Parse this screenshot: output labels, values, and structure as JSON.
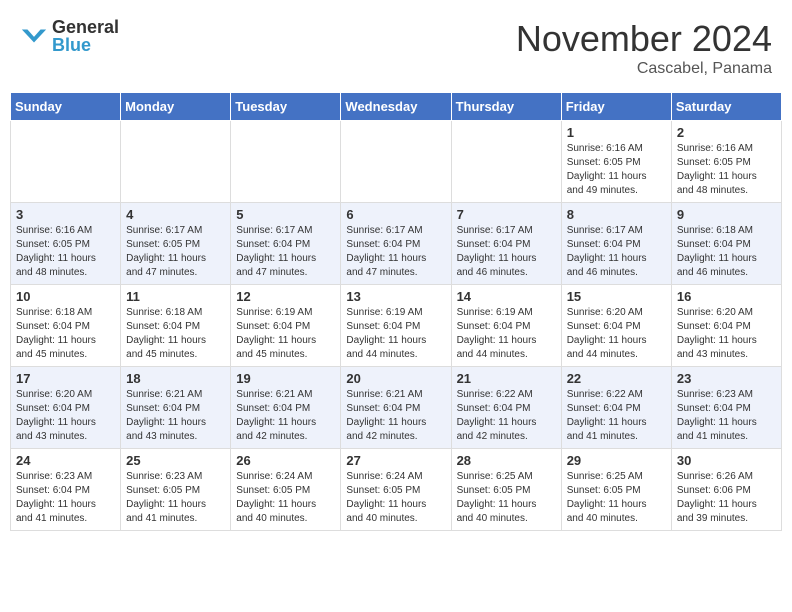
{
  "logo": {
    "general": "General",
    "blue": "Blue"
  },
  "title": "November 2024",
  "location": "Cascabel, Panama",
  "days_of_week": [
    "Sunday",
    "Monday",
    "Tuesday",
    "Wednesday",
    "Thursday",
    "Friday",
    "Saturday"
  ],
  "weeks": [
    [
      {
        "day": "",
        "info": ""
      },
      {
        "day": "",
        "info": ""
      },
      {
        "day": "",
        "info": ""
      },
      {
        "day": "",
        "info": ""
      },
      {
        "day": "",
        "info": ""
      },
      {
        "day": "1",
        "info": "Sunrise: 6:16 AM\nSunset: 6:05 PM\nDaylight: 11 hours and 49 minutes."
      },
      {
        "day": "2",
        "info": "Sunrise: 6:16 AM\nSunset: 6:05 PM\nDaylight: 11 hours and 48 minutes."
      }
    ],
    [
      {
        "day": "3",
        "info": "Sunrise: 6:16 AM\nSunset: 6:05 PM\nDaylight: 11 hours and 48 minutes."
      },
      {
        "day": "4",
        "info": "Sunrise: 6:17 AM\nSunset: 6:05 PM\nDaylight: 11 hours and 47 minutes."
      },
      {
        "day": "5",
        "info": "Sunrise: 6:17 AM\nSunset: 6:04 PM\nDaylight: 11 hours and 47 minutes."
      },
      {
        "day": "6",
        "info": "Sunrise: 6:17 AM\nSunset: 6:04 PM\nDaylight: 11 hours and 47 minutes."
      },
      {
        "day": "7",
        "info": "Sunrise: 6:17 AM\nSunset: 6:04 PM\nDaylight: 11 hours and 46 minutes."
      },
      {
        "day": "8",
        "info": "Sunrise: 6:17 AM\nSunset: 6:04 PM\nDaylight: 11 hours and 46 minutes."
      },
      {
        "day": "9",
        "info": "Sunrise: 6:18 AM\nSunset: 6:04 PM\nDaylight: 11 hours and 46 minutes."
      }
    ],
    [
      {
        "day": "10",
        "info": "Sunrise: 6:18 AM\nSunset: 6:04 PM\nDaylight: 11 hours and 45 minutes."
      },
      {
        "day": "11",
        "info": "Sunrise: 6:18 AM\nSunset: 6:04 PM\nDaylight: 11 hours and 45 minutes."
      },
      {
        "day": "12",
        "info": "Sunrise: 6:19 AM\nSunset: 6:04 PM\nDaylight: 11 hours and 45 minutes."
      },
      {
        "day": "13",
        "info": "Sunrise: 6:19 AM\nSunset: 6:04 PM\nDaylight: 11 hours and 44 minutes."
      },
      {
        "day": "14",
        "info": "Sunrise: 6:19 AM\nSunset: 6:04 PM\nDaylight: 11 hours and 44 minutes."
      },
      {
        "day": "15",
        "info": "Sunrise: 6:20 AM\nSunset: 6:04 PM\nDaylight: 11 hours and 44 minutes."
      },
      {
        "day": "16",
        "info": "Sunrise: 6:20 AM\nSunset: 6:04 PM\nDaylight: 11 hours and 43 minutes."
      }
    ],
    [
      {
        "day": "17",
        "info": "Sunrise: 6:20 AM\nSunset: 6:04 PM\nDaylight: 11 hours and 43 minutes."
      },
      {
        "day": "18",
        "info": "Sunrise: 6:21 AM\nSunset: 6:04 PM\nDaylight: 11 hours and 43 minutes."
      },
      {
        "day": "19",
        "info": "Sunrise: 6:21 AM\nSunset: 6:04 PM\nDaylight: 11 hours and 42 minutes."
      },
      {
        "day": "20",
        "info": "Sunrise: 6:21 AM\nSunset: 6:04 PM\nDaylight: 11 hours and 42 minutes."
      },
      {
        "day": "21",
        "info": "Sunrise: 6:22 AM\nSunset: 6:04 PM\nDaylight: 11 hours and 42 minutes."
      },
      {
        "day": "22",
        "info": "Sunrise: 6:22 AM\nSunset: 6:04 PM\nDaylight: 11 hours and 41 minutes."
      },
      {
        "day": "23",
        "info": "Sunrise: 6:23 AM\nSunset: 6:04 PM\nDaylight: 11 hours and 41 minutes."
      }
    ],
    [
      {
        "day": "24",
        "info": "Sunrise: 6:23 AM\nSunset: 6:04 PM\nDaylight: 11 hours and 41 minutes."
      },
      {
        "day": "25",
        "info": "Sunrise: 6:23 AM\nSunset: 6:05 PM\nDaylight: 11 hours and 41 minutes."
      },
      {
        "day": "26",
        "info": "Sunrise: 6:24 AM\nSunset: 6:05 PM\nDaylight: 11 hours and 40 minutes."
      },
      {
        "day": "27",
        "info": "Sunrise: 6:24 AM\nSunset: 6:05 PM\nDaylight: 11 hours and 40 minutes."
      },
      {
        "day": "28",
        "info": "Sunrise: 6:25 AM\nSunset: 6:05 PM\nDaylight: 11 hours and 40 minutes."
      },
      {
        "day": "29",
        "info": "Sunrise: 6:25 AM\nSunset: 6:05 PM\nDaylight: 11 hours and 40 minutes."
      },
      {
        "day": "30",
        "info": "Sunrise: 6:26 AM\nSunset: 6:06 PM\nDaylight: 11 hours and 39 minutes."
      }
    ]
  ]
}
